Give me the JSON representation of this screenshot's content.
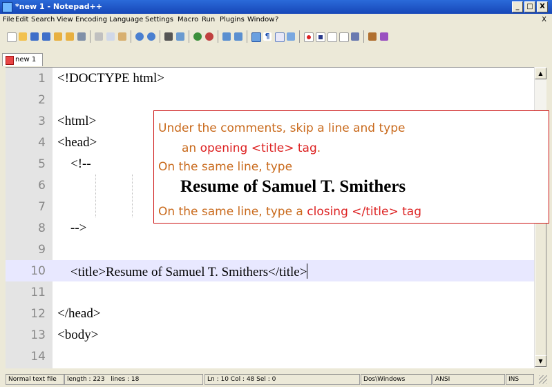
{
  "window": {
    "title": "*new 1 - Notepad++",
    "controls": {
      "minimize": "_",
      "maximize": "□",
      "close": "X"
    }
  },
  "menu": {
    "items": [
      "File",
      "Edit",
      "Search",
      "View",
      "Encoding",
      "Language",
      "Settings",
      "Macro",
      "Run",
      "Plugins",
      "Window",
      "?"
    ],
    "close": "X"
  },
  "toolbar": {
    "icons": [
      "new-file-icon",
      "open-file-icon",
      "save-icon",
      "save-all-icon",
      "close-icon",
      "close-all-icon",
      "print-icon",
      "cut-icon",
      "copy-icon",
      "paste-icon",
      "undo-icon",
      "redo-icon",
      "find-icon",
      "replace-icon",
      "zoom-in-icon",
      "zoom-out-icon",
      "sync-v-icon",
      "sync-h-icon",
      "word-wrap-icon",
      "show-all-chars-icon",
      "indent-guide-icon",
      "doc-map-icon",
      "record-macro-icon",
      "stop-record-icon",
      "play-macro-icon",
      "run-macro-multiple-icon",
      "save-macro-icon",
      "spellcheck-icon",
      "abc-icon"
    ]
  },
  "tabs": [
    {
      "label": "new 1"
    }
  ],
  "editor": {
    "lines": [
      {
        "num": "1",
        "text": "<!DOCTYPE html>"
      },
      {
        "num": "2",
        "text": ""
      },
      {
        "num": "3",
        "text": "<html>"
      },
      {
        "num": "4",
        "text": "<head>"
      },
      {
        "num": "5",
        "text": "    <!--"
      },
      {
        "num": "6",
        "text": ""
      },
      {
        "num": "7",
        "text": ""
      },
      {
        "num": "8",
        "text": "    -->"
      },
      {
        "num": "9",
        "text": ""
      },
      {
        "num": "10",
        "text": "    <title>Resume of Samuel T. Smithers</title>"
      },
      {
        "num": "11",
        "text": ""
      },
      {
        "num": "12",
        "text": "</head>"
      },
      {
        "num": "13",
        "text": "<body>"
      },
      {
        "num": "14",
        "text": ""
      }
    ],
    "active_line": "10"
  },
  "callout": {
    "line1": "Under the comments, skip a line and type",
    "line2_a": "an ",
    "line2_b": "opening <title> tag",
    "line2_c": ".",
    "line3": "On the same line, type",
    "line4": "Resume of Samuel T. Smithers",
    "line5_a": "On the same line, type a ",
    "line5_b": "closing </title> tag",
    "colors": {
      "text": "#c96a1c",
      "highlight": "#dd2222",
      "border": "#cc1111"
    }
  },
  "status": {
    "filetype": "Normal text file",
    "length": "length : 223",
    "lines": "lines : 18",
    "position": "Ln : 10    Col : 48    Sel : 0",
    "eol": "Dos\\Windows",
    "encoding": "ANSI",
    "mode": "INS"
  }
}
